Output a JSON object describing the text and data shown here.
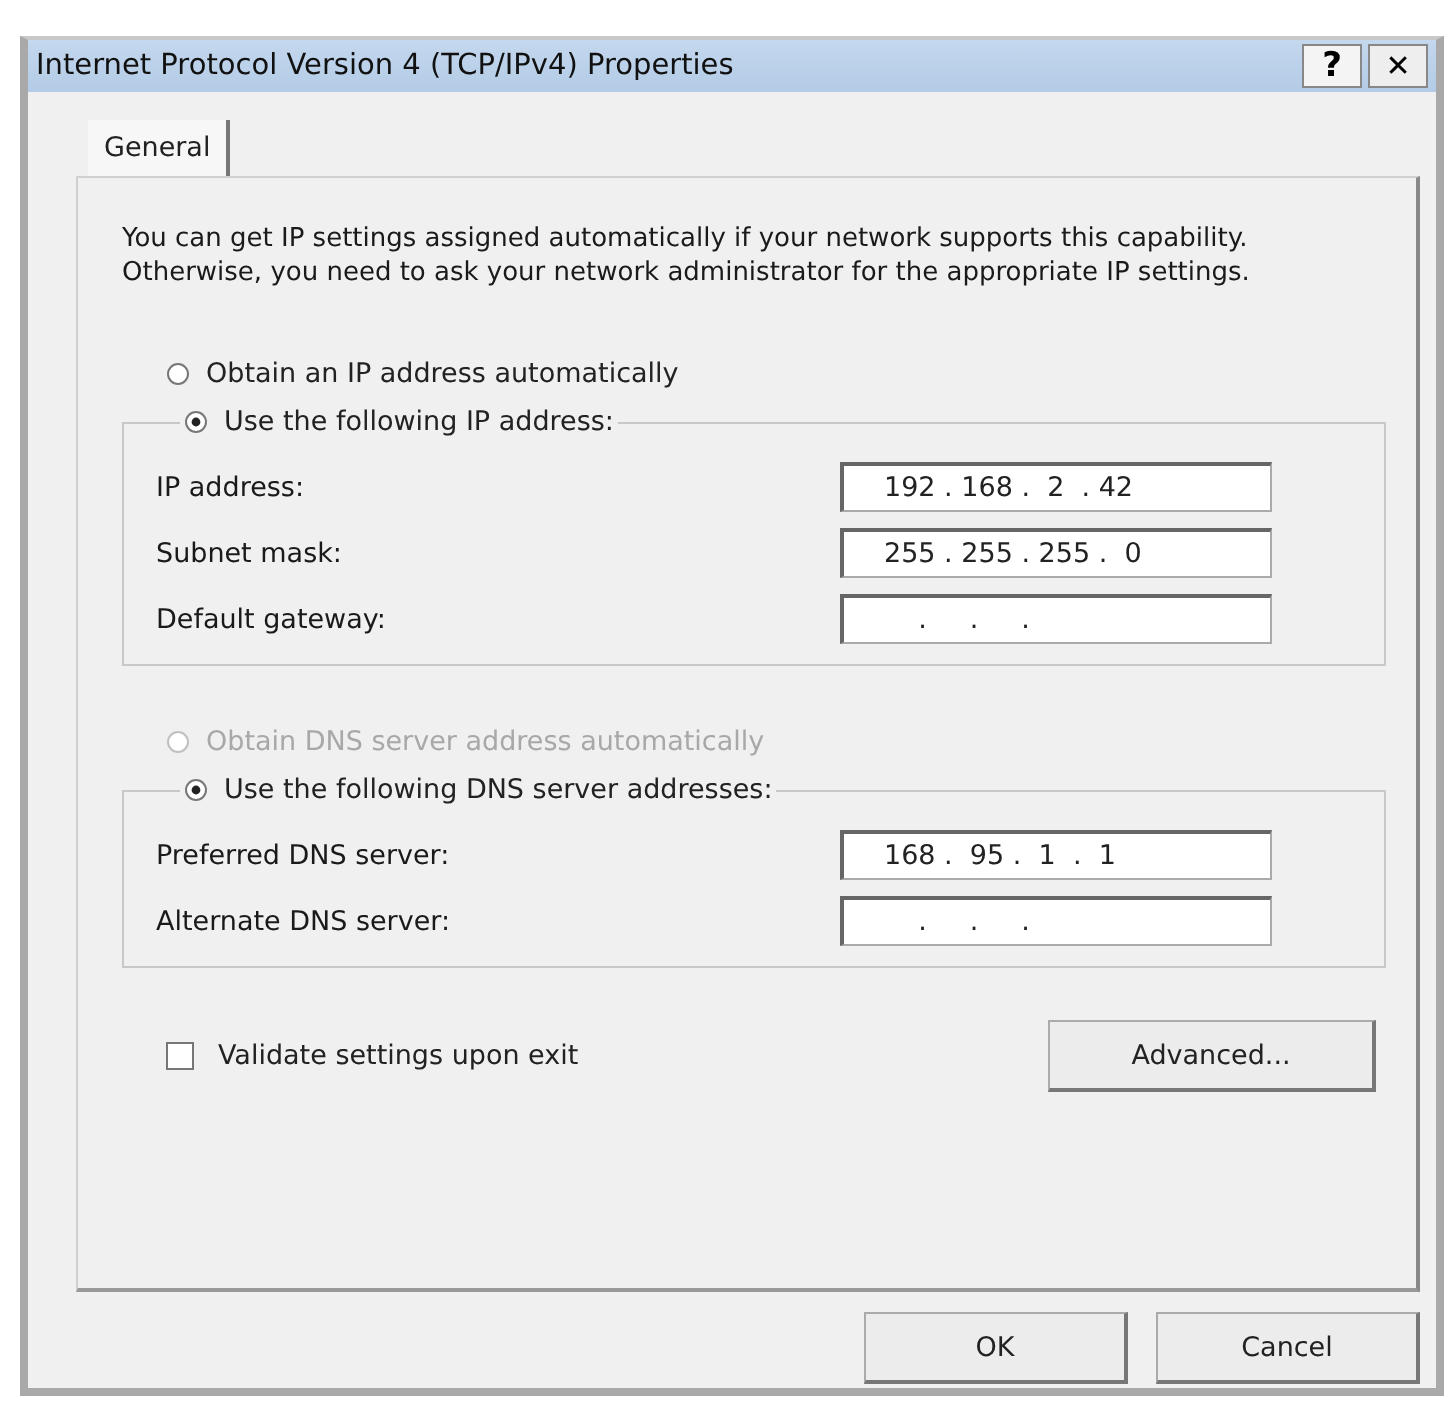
{
  "window": {
    "title": "Internet Protocol Version 4 (TCP/IPv4) Properties",
    "buttons": [
      {
        "kind": "help",
        "label": "?"
      },
      {
        "kind": "close",
        "label": "✕"
      }
    ]
  },
  "tabs": [
    {
      "label": "General",
      "selected": true
    }
  ],
  "description": "You can get IP settings assigned automatically if your network supports this capability. Otherwise, you need to ask your network administrator for the appropriate IP settings.",
  "ip_section": {
    "auto_option": {
      "label": "Obtain an IP address automatically",
      "selected": false,
      "disabled": false
    },
    "manual_option": {
      "label": "Use the following IP address:",
      "selected": true,
      "disabled": false
    },
    "fields": [
      {
        "label": "IP address:",
        "value": "192 . 168 .  2  . 42"
      },
      {
        "label": "Subnet mask:",
        "value": "255 . 255 . 255 .  0"
      },
      {
        "label": "Default gateway:",
        "value": "    .     .     ."
      }
    ]
  },
  "dns_section": {
    "auto_option": {
      "label": "Obtain DNS server address automatically",
      "selected": false,
      "disabled": true
    },
    "manual_option": {
      "label": "Use the following DNS server addresses:",
      "selected": true,
      "disabled": false
    },
    "fields": [
      {
        "label": "Preferred DNS server:",
        "value": "168 .  95 .  1  .  1"
      },
      {
        "label": "Alternate DNS server:",
        "value": "    .     .     ."
      }
    ]
  },
  "validate": {
    "label": "Validate settings upon exit",
    "checked": false
  },
  "advanced_button": "Advanced...",
  "buttons": [
    "OK",
    "Cancel"
  ]
}
